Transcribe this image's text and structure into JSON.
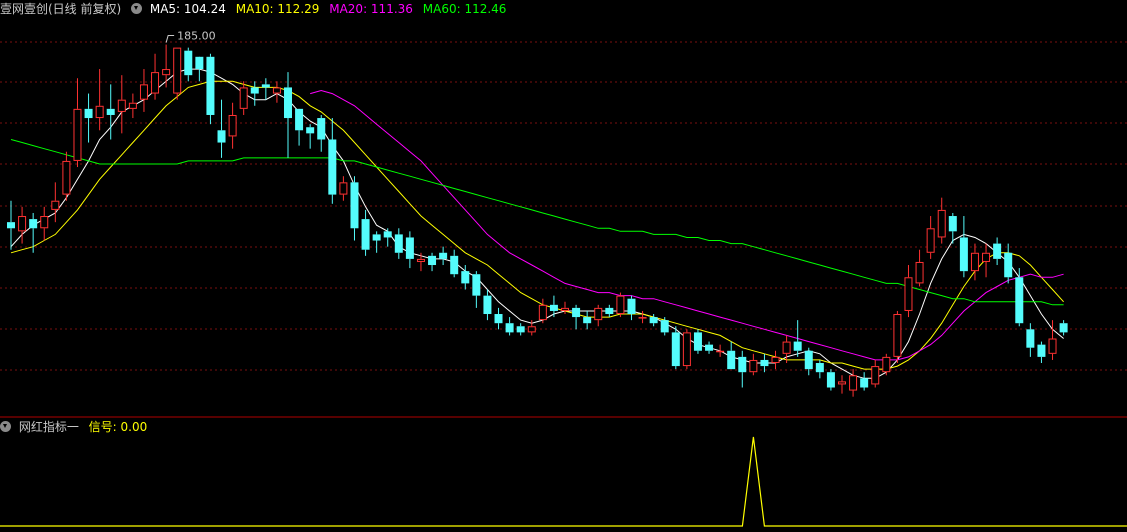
{
  "main_header": {
    "title": "壹网壹创(日线 前复权)",
    "ma5": "MA5: 104.24",
    "ma10": "MA10: 112.29",
    "ma20": "MA20: 111.36",
    "ma60": "MA60: 112.46"
  },
  "sub_header": {
    "title": "网红指标一",
    "signal": "信号: 0.00"
  },
  "colors": {
    "up": "#ff3232",
    "down": "#54fcfc",
    "ma5": "#ffffff",
    "ma10": "#ffff00",
    "ma20": "#ff00ff",
    "ma60": "#00ff00",
    "signal": "#ffff00",
    "grid": "#7a1010",
    "divider": "#b00000"
  },
  "peak_label": "185.00",
  "chart_data": [
    {
      "type": "candlestick",
      "title": "壹网壹创(日线 前复权)",
      "note": "Prices estimated visually; the only printed price is the peak high 185.00. Index = trading day (0..92).",
      "ylim": [
        66,
        195
      ],
      "candles": [
        [
          128,
          126,
          135,
          119
        ],
        [
          125,
          130,
          133,
          121
        ],
        [
          129,
          126,
          131,
          118
        ],
        [
          126,
          130,
          133,
          122
        ],
        [
          132,
          135,
          141,
          128
        ],
        [
          137,
          148,
          151,
          135
        ],
        [
          148,
          165,
          175,
          146
        ],
        [
          165,
          162,
          170,
          154
        ],
        [
          162,
          166,
          178,
          158
        ],
        [
          165,
          163,
          173,
          155
        ],
        [
          164,
          168,
          176,
          157
        ],
        [
          165,
          167,
          170,
          162
        ],
        [
          168,
          173,
          178,
          164
        ],
        [
          170,
          177,
          183,
          168
        ],
        [
          176,
          178,
          186,
          172
        ],
        [
          170,
          185,
          185,
          168
        ],
        [
          184,
          176,
          185,
          174
        ],
        [
          182,
          178,
          181,
          174
        ],
        [
          182,
          163,
          183,
          160
        ],
        [
          158,
          154,
          168,
          149
        ],
        [
          156,
          163,
          167,
          152
        ],
        [
          165,
          172,
          174,
          163
        ],
        [
          172,
          170,
          174,
          166
        ],
        [
          173,
          172,
          175,
          168
        ],
        [
          170,
          172,
          174,
          167
        ],
        [
          172,
          162,
          177,
          149
        ],
        [
          165,
          158,
          162,
          153
        ],
        [
          159,
          157,
          160,
          152
        ],
        [
          162,
          155,
          163,
          151
        ],
        [
          155,
          137,
          162,
          134
        ],
        [
          137,
          141,
          143,
          135
        ],
        [
          141,
          126,
          143,
          122
        ],
        [
          129,
          119,
          132,
          117
        ],
        [
          124,
          122,
          125,
          118
        ],
        [
          125,
          123,
          126,
          120
        ],
        [
          124,
          118,
          126,
          116
        ],
        [
          123,
          116,
          125,
          113
        ],
        [
          115,
          116,
          118,
          112
        ],
        [
          117,
          114,
          118,
          112
        ],
        [
          118,
          116,
          120,
          114
        ],
        [
          117,
          111,
          119,
          110
        ],
        [
          112,
          108,
          114,
          106
        ],
        [
          111,
          104,
          112,
          100
        ],
        [
          104,
          98,
          106,
          96
        ],
        [
          98,
          95,
          100,
          93
        ],
        [
          95,
          92,
          97,
          91
        ],
        [
          94,
          92,
          95,
          91
        ],
        [
          92,
          94,
          96,
          91
        ],
        [
          96,
          101,
          103,
          95
        ],
        [
          101,
          99,
          104,
          97
        ],
        [
          99,
          100,
          102,
          98
        ],
        [
          100,
          97,
          101,
          93
        ],
        [
          97,
          95,
          99,
          93
        ],
        [
          96,
          100,
          101,
          94
        ],
        [
          100,
          98,
          101,
          97
        ],
        [
          98,
          104,
          105,
          97
        ],
        [
          103,
          98,
          104,
          96
        ],
        [
          97,
          97,
          99,
          95
        ],
        [
          97,
          95,
          98,
          94
        ],
        [
          96,
          92,
          97,
          91
        ],
        [
          92,
          81,
          94,
          80
        ],
        [
          81,
          92,
          93,
          80
        ],
        [
          92,
          86,
          93,
          85
        ],
        [
          88,
          86,
          89,
          85
        ],
        [
          86,
          86,
          88,
          84
        ],
        [
          86,
          80,
          89,
          80
        ],
        [
          84,
          79,
          86,
          74
        ],
        [
          79,
          83,
          85,
          78
        ],
        [
          83,
          81,
          85,
          79
        ],
        [
          82,
          84,
          86,
          80
        ],
        [
          85,
          89,
          91,
          82
        ],
        [
          89,
          86,
          96,
          84
        ],
        [
          86,
          80,
          87,
          78
        ],
        [
          82,
          79,
          83,
          77
        ],
        [
          79,
          74,
          80,
          73
        ],
        [
          75,
          76,
          78,
          72
        ],
        [
          73,
          78,
          80,
          71
        ],
        [
          77,
          74,
          79,
          73
        ],
        [
          75,
          81,
          83,
          74
        ],
        [
          79,
          84,
          85,
          78
        ],
        [
          84,
          98,
          99,
          82
        ],
        [
          99,
          110,
          114,
          97
        ],
        [
          108,
          115,
          119,
          107
        ],
        [
          118,
          126,
          130,
          116
        ],
        [
          123,
          132,
          136,
          121
        ],
        [
          130,
          125,
          131,
          121
        ],
        [
          123,
          112,
          130,
          110
        ],
        [
          112,
          118,
          121,
          109
        ],
        [
          115,
          118,
          121,
          110
        ],
        [
          121,
          116,
          123,
          114
        ],
        [
          118,
          110,
          121,
          108
        ],
        [
          110,
          95,
          113,
          94
        ],
        [
          93,
          87,
          95,
          84
        ],
        [
          88,
          84,
          89,
          82
        ],
        [
          85,
          90,
          96,
          83
        ],
        [
          95,
          92,
          96,
          91
        ]
      ],
      "ma": {
        "MA5": [
          120,
          124,
          127,
          129,
          131,
          136,
          142,
          148,
          155,
          159,
          164,
          166,
          168,
          171,
          174,
          177,
          178,
          178,
          177,
          175,
          173,
          170,
          168,
          168,
          170,
          168,
          164,
          161,
          159,
          153,
          148,
          140,
          133,
          127,
          125,
          120,
          118,
          117,
          116,
          116,
          115,
          112,
          110,
          106,
          102,
          99,
          96,
          95,
          96,
          98,
          99,
          99,
          99,
          99,
          99,
          99,
          99,
          98,
          97,
          95,
          93,
          90,
          88,
          87,
          86,
          84,
          83,
          82,
          82,
          82,
          84,
          85,
          86,
          85,
          82,
          80,
          78,
          77,
          77,
          79,
          83,
          89,
          98,
          108,
          116,
          122,
          124,
          123,
          121,
          118,
          115,
          110,
          104,
          98,
          93,
          90
        ],
        "MA10": [
          118,
          119,
          120,
          122,
          124,
          128,
          132,
          137,
          142,
          146,
          150,
          154,
          158,
          162,
          166,
          169,
          172,
          173,
          174,
          174,
          174,
          173,
          172,
          172,
          172,
          171,
          169,
          166,
          164,
          161,
          158,
          154,
          150,
          146,
          142,
          138,
          134,
          130,
          127,
          124,
          121,
          118,
          116,
          114,
          111,
          108,
          105,
          103,
          101,
          100,
          99,
          98,
          97,
          97,
          97,
          98,
          98,
          98,
          97,
          96,
          95,
          94,
          93,
          92,
          91,
          89,
          87,
          86,
          85,
          84,
          83,
          83,
          83,
          83,
          82,
          82,
          81,
          80,
          80,
          80,
          81,
          83,
          86,
          90,
          95,
          101,
          107,
          112,
          116,
          118,
          118,
          117,
          114,
          110,
          106,
          102
        ],
        "MA20": [
          null,
          null,
          null,
          null,
          null,
          null,
          null,
          null,
          null,
          null,
          null,
          null,
          null,
          null,
          null,
          null,
          null,
          null,
          null,
          null,
          null,
          null,
          null,
          null,
          null,
          null,
          null,
          170,
          171,
          170,
          168,
          166,
          163,
          160,
          157,
          154,
          151,
          148,
          144,
          140,
          136,
          132,
          128,
          124,
          121,
          118,
          116,
          114,
          112,
          110,
          108,
          107,
          106,
          105,
          105,
          104,
          104,
          103,
          103,
          102,
          101,
          100,
          99,
          98,
          97,
          96,
          95,
          94,
          93,
          92,
          91,
          90,
          89,
          88,
          87,
          86,
          85,
          84,
          83,
          83,
          83,
          84,
          86,
          88,
          91,
          95,
          99,
          102,
          105,
          107,
          109,
          110,
          111,
          110,
          110,
          111
        ],
        "MA60": [
          155,
          154,
          153,
          152,
          151,
          150,
          149,
          148,
          147,
          147,
          147,
          147,
          147,
          147,
          147,
          147,
          148,
          148,
          148,
          148,
          148,
          149,
          149,
          149,
          149,
          149,
          149,
          149,
          149,
          149,
          148,
          148,
          147,
          146,
          145,
          144,
          143,
          142,
          141,
          140,
          139,
          138,
          137,
          136,
          135,
          134,
          133,
          132,
          131,
          130,
          129,
          128,
          127,
          126,
          126,
          125,
          125,
          125,
          124,
          124,
          124,
          123,
          123,
          122,
          122,
          121,
          121,
          120,
          119,
          118,
          117,
          116,
          115,
          114,
          113,
          112,
          111,
          110,
          109,
          108,
          108,
          107,
          106,
          105,
          104,
          103,
          103,
          102,
          102,
          102,
          102,
          102,
          102,
          102,
          101,
          101
        ]
      }
    },
    {
      "type": "line",
      "title": "网红指标一",
      "series": [
        {
          "name": "信号",
          "values_note": "0 everywhere except a single spike at day 67",
          "spike_index": 67,
          "spike_value": 1
        }
      ],
      "ylim": [
        0,
        1
      ]
    }
  ]
}
